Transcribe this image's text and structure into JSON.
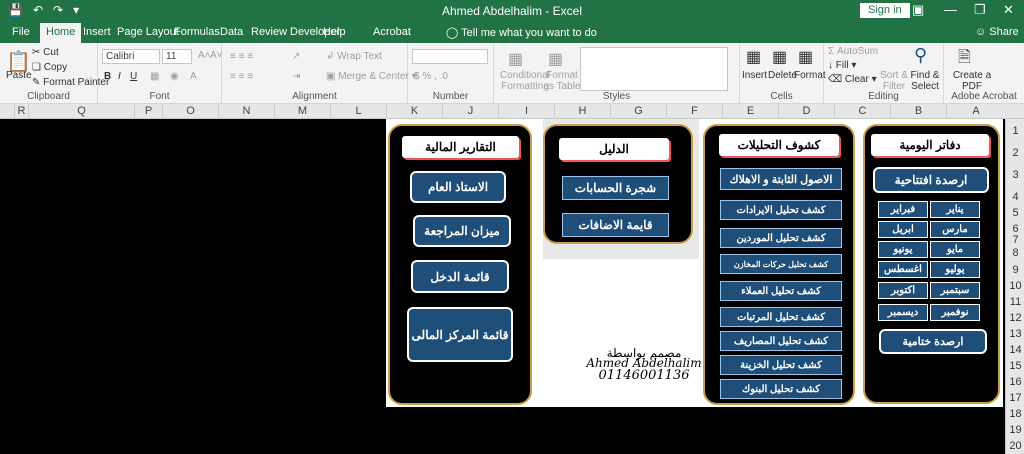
{
  "window": {
    "title": "Ahmed Abdelhalim  -  Excel",
    "signin": "Sign in"
  },
  "tabs": [
    "File",
    "Home",
    "Insert",
    "Page Layout",
    "Formulas",
    "Data",
    "Review",
    "Developer",
    "Help",
    "Acrobat"
  ],
  "tell_me": "Tell me what you want to do",
  "share": "Share",
  "ribbon": {
    "paste": "Paste",
    "cut": "Cut",
    "copy": "Copy",
    "format_painter": "Format Painter",
    "clipboard": "Clipboard",
    "font_name": "Calibri",
    "font_size": "11",
    "font": "Font",
    "wrap_text": "Wrap Text",
    "merge_center": "Merge & Center",
    "alignment": "Alignment",
    "number": "Number",
    "conditional_formatting": "Conditional Formatting",
    "format_as_table": "Format as Table",
    "styles": "Styles",
    "insert": "Insert",
    "delete": "Delete",
    "format": "Format",
    "cells": "Cells",
    "autosum": "AutoSum",
    "fill": "Fill",
    "clear": "Clear",
    "sort_filter": "Sort & Filter",
    "find_select": "Find & Select",
    "editing": "Editing",
    "create_pdf": "Create a PDF",
    "adobe_acrobat": "Adobe Acrobat"
  },
  "columns": [
    "R",
    "Q",
    "P",
    "O",
    "N",
    "M",
    "L",
    "K",
    "J",
    "I",
    "H",
    "G",
    "F",
    "E",
    "D",
    "C",
    "B",
    "A"
  ],
  "rows": [
    "1",
    "2",
    "3",
    "4",
    "5",
    "6",
    "7",
    "8",
    "9",
    "10",
    "11",
    "12",
    "13",
    "14",
    "15",
    "16",
    "17",
    "18",
    "19",
    "20"
  ],
  "panels": {
    "journals": {
      "title": "دفاتر اليومية",
      "opening": "ارصدة افتتاحية",
      "closing": "ارصدة ختامية",
      "months": [
        [
          "يناير",
          "فبراير"
        ],
        [
          "مارس",
          "ابريل"
        ],
        [
          "مايو",
          "يونيو"
        ],
        [
          "يوليو",
          "اغسطس"
        ],
        [
          "سبتمبر",
          "اكتوبر"
        ],
        [
          "نوفمبر",
          "ديسمبر"
        ]
      ]
    },
    "analysis": {
      "title": "كشوف التحليلات",
      "items": [
        "الاصول الثابتة و الاهلاك",
        "كشف تحليل الايرادات",
        "كشف تحليل الموردين",
        "كشف تحليل حركات المخازن",
        "كشف تحليل العملاء",
        "كشف تحليل المرتبات",
        "كشف تحليل المصاريف",
        "كشف تحليل الخزينة",
        "كشف تحليل البنوك"
      ]
    },
    "guide": {
      "title": "الدليل",
      "items": [
        "شجرة الحسابات",
        "قايمة الاضافات"
      ]
    },
    "reports": {
      "title": "التقارير المالية",
      "items": [
        "الاستاذ العام",
        "ميزان المراجعة",
        "قائمة الدخل",
        "قائمة المركز المالى"
      ]
    }
  },
  "signature": {
    "line1": "مصمم بواسطة",
    "line2": "Ahmed Abdelhalim",
    "line3": "01146001136"
  }
}
